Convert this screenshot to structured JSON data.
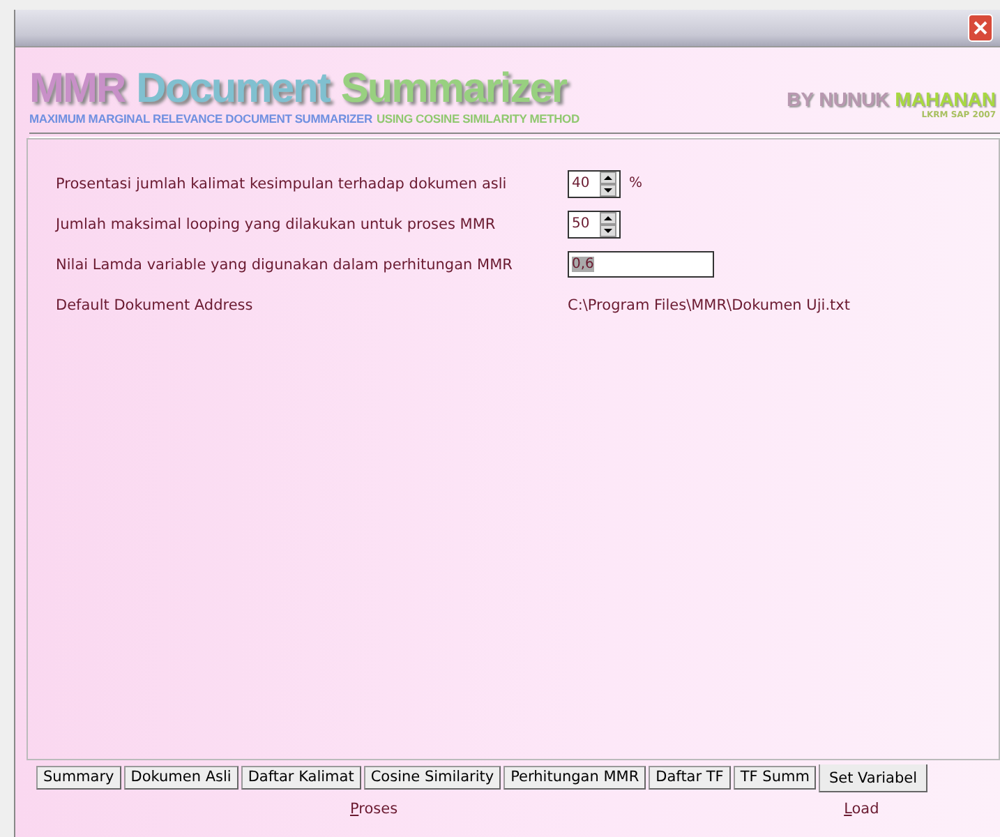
{
  "header": {
    "logo_words": [
      {
        "text": "MMR",
        "color": "#c890c8"
      },
      {
        "text": "Document",
        "color": "#80c0d0"
      },
      {
        "text": "Summarizer",
        "color": "#98d080"
      }
    ],
    "subtitle_parts": [
      {
        "text": "MAXIMUM MARGINAL RELEVANCE DOCUMENT SUMMARIZER",
        "color": "#7090e0"
      },
      {
        "text": "USING COSINE SIMILARITY METHOD",
        "color": "#90c870"
      }
    ],
    "author_parts": [
      {
        "text": "BY NUNUK",
        "color": "#b898b0"
      },
      {
        "text": "MAHANAN",
        "color": "#a8d840"
      }
    ],
    "author_note": "LKRM SAP 2007"
  },
  "settings": [
    {
      "kind": "spin",
      "label": "Prosentasi jumlah kalimat kesimpulan terhadap dokumen asli",
      "value": "40",
      "unit": "%"
    },
    {
      "kind": "spin",
      "label": "Jumlah maksimal looping yang dilakukan untuk proses MMR",
      "value": "50"
    },
    {
      "kind": "text",
      "label": "Nilai Lamda variable yang digunakan dalam perhitungan MMR",
      "value": "0,6",
      "selected": true
    },
    {
      "kind": "static",
      "label": "Default Dokument Address",
      "value": "C:\\Program Files\\MMR\\Dokumen Uji.txt"
    }
  ],
  "tabs": [
    {
      "label": "Summary",
      "selected": false
    },
    {
      "label": "Dokumen Asli",
      "selected": false
    },
    {
      "label": "Daftar Kalimat",
      "selected": false
    },
    {
      "label": "Cosine Similarity",
      "selected": false
    },
    {
      "label": "Perhitungan MMR",
      "selected": false
    },
    {
      "label": "Daftar TF",
      "selected": false
    },
    {
      "label": "TF Summ",
      "selected": false
    },
    {
      "label": "Set Variabel",
      "selected": true
    }
  ],
  "buttons": [
    {
      "label": "Proses"
    },
    {
      "label": "Load"
    }
  ]
}
